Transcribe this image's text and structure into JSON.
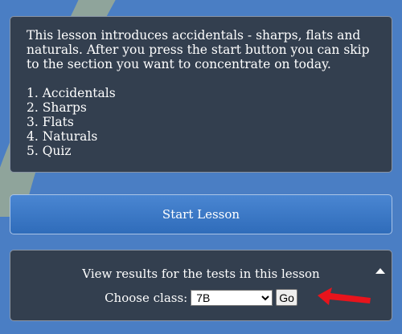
{
  "intro": {
    "text": "This lesson introduces accidentals - sharps, flats and naturals. After you press the start button you can skip to the section you want to concentrate on today.",
    "sections": [
      "1. Accidentals",
      "2. Sharps",
      "3. Flats",
      "4. Naturals",
      "5. Quiz"
    ]
  },
  "start_button": {
    "label": "Start Lesson"
  },
  "results": {
    "title": "View results for the tests in this lesson",
    "class_label": "Choose class:",
    "selected_class": "7B",
    "go_label": "Go"
  },
  "colors": {
    "page_background": "#4a7ec4",
    "panel_background": "#333f4f",
    "button_blue": "#3a78c6",
    "annotation_arrow": "#e8141c"
  },
  "icons": {
    "collapse": "chevron-up-icon",
    "annotation": "red-arrow-icon"
  }
}
